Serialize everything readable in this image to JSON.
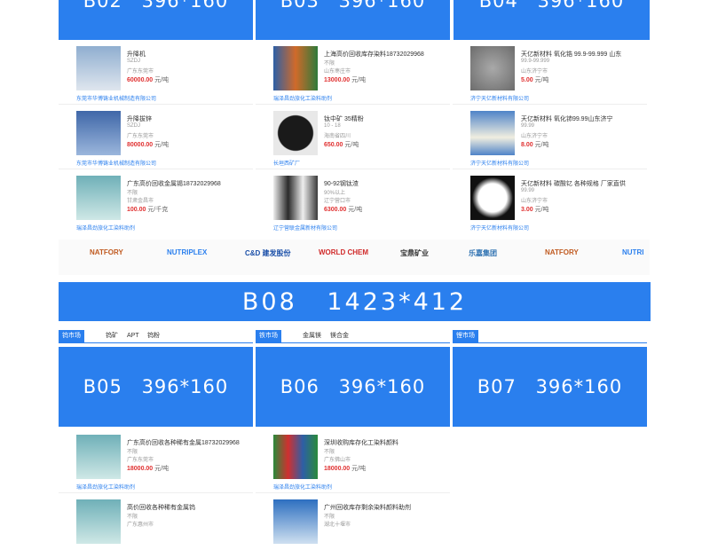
{
  "top_ads": [
    "B02   396*160",
    "B03   396*160",
    "B04   396*160"
  ],
  "columns": [
    {
      "items": [
        {
          "title": "升降机",
          "spec": "SZDJ",
          "loc": "广东东莞市",
          "price": "60000.00",
          "unit": "元/吨",
          "company": "东莞市华博铸业机械制造有限公司"
        },
        {
          "title": "升降拔锌",
          "spec": "SZDJ",
          "loc": "广东东莞市",
          "price": "80000.00",
          "unit": "元/吨",
          "company": "东莞市华博铸业机械制造有限公司"
        },
        {
          "title": "广东高价回收金属锡18732029968",
          "spec": "不限",
          "loc": "甘肃金昌市",
          "price": "100.00",
          "unit": "元/千克",
          "company": "瑞泽昌劲旅化工染料助剂"
        }
      ]
    },
    {
      "items": [
        {
          "title": "上海高价回收库存染料18732029968",
          "spec": "不限",
          "loc": "山东枣庄市",
          "price": "13000.00",
          "unit": "元/吨",
          "company": "瑞泽昌劲旅化工染料助剂"
        },
        {
          "title": "钛中矿 35精粉",
          "spec": "10 - 18",
          "loc": "海南省四川",
          "price": "650.00",
          "unit": "元/吨",
          "company": "长垣西矿厂"
        },
        {
          "title": "90-92钢钛渣",
          "spec": "90%以上",
          "loc": "辽宁营口市",
          "price": "6300.00",
          "unit": "元/吨",
          "company": "辽宁营联金属新材有限公司"
        }
      ]
    },
    {
      "items": [
        {
          "title": "天亿新材料 氧化锆 99.9-99.999 山东",
          "spec": "99.9-99.999",
          "loc": "山东济宁市",
          "price": "5.00",
          "unit": "元/吨",
          "company": "济宁天亿新材料有限公司"
        },
        {
          "title": "天亿新材料 氧化铈99.99山东济宁",
          "spec": "99.99",
          "loc": "山东济宁市",
          "price": "8.00",
          "unit": "元/吨",
          "company": "济宁天亿新材料有限公司"
        },
        {
          "title": "天亿新材料 碳酸钇 各种规格 厂家直供",
          "spec": "99.99",
          "loc": "山东济宁市",
          "price": "3.00",
          "unit": "元/吨",
          "company": "济宁天亿新材料有限公司"
        }
      ]
    }
  ],
  "logos": [
    "NATFORY",
    "NUTRIPLEX",
    "C&D 建发股份",
    "WORLD CHEM",
    "宝鼎矿业",
    "乐嘉集团",
    "NATFORY",
    "NUTRI"
  ],
  "b08": "B08   1423*412",
  "markets": [
    {
      "active": "钨市场",
      "tabs": [
        "钨矿",
        "APT",
        "钨粉"
      ],
      "ad": "B05   396*160"
    },
    {
      "active": "铁市场",
      "tabs": [
        "金属镁",
        "镁合金"
      ],
      "ad": "B06   396*160"
    },
    {
      "active": "锂市场",
      "tabs": [],
      "ad": "B07   396*160"
    }
  ],
  "bottom_items": [
    [
      {
        "title": "广东高价回收各种稀有金属18732029968",
        "spec": "不限",
        "loc": "广东东莞市",
        "price": "18000.00",
        "unit": "元/吨",
        "company": "瑞泽昌劲旅化工染料助剂"
      },
      {
        "title": "高价回收各种稀有金属钨",
        "spec": "不限",
        "loc": "广东惠州市",
        "price": "",
        "unit": "",
        "company": ""
      }
    ],
    [
      {
        "title": "深圳收购库存化工染料颜料",
        "spec": "不限",
        "loc": "广东佛山市",
        "price": "18000.00",
        "unit": "元/吨",
        "company": "瑞泽昌劲旅化工染料助剂"
      },
      {
        "title": "广州回收库存剩余染料颜料助剂",
        "spec": "不限",
        "loc": "湖北十堰市",
        "price": "",
        "unit": "",
        "company": ""
      }
    ]
  ],
  "colors": {
    "accent": "#2a7fee",
    "price": "#e03030"
  }
}
